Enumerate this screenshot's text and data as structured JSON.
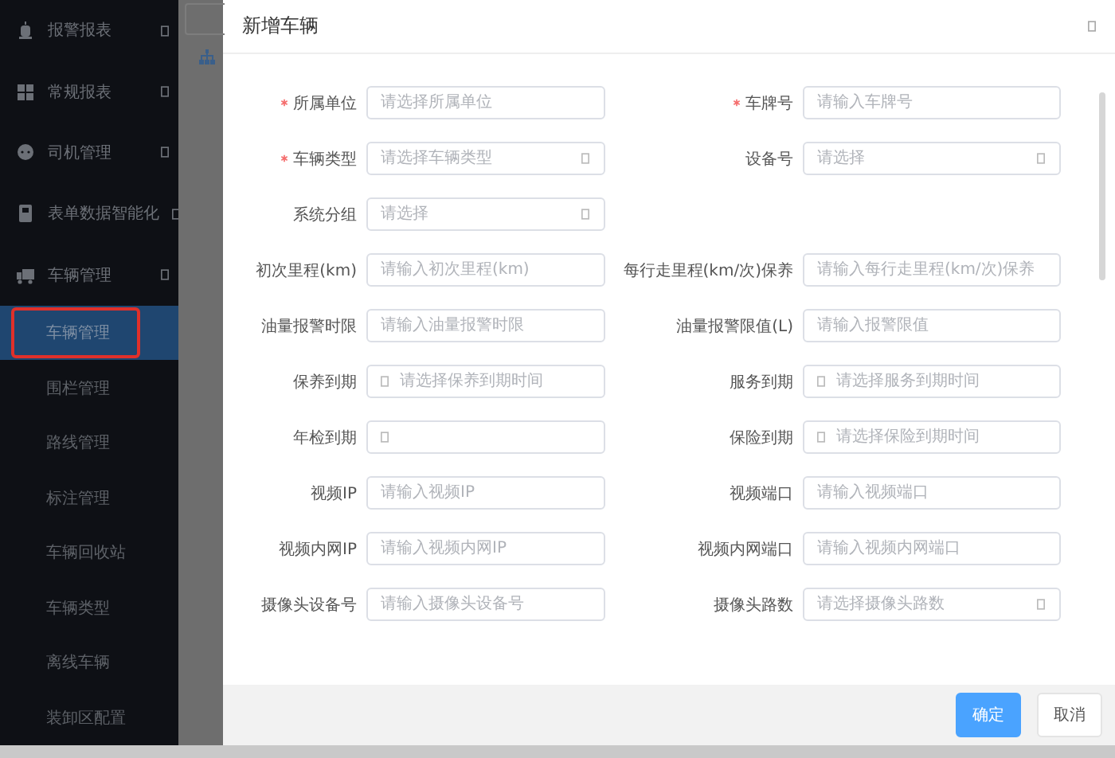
{
  "sidebar": {
    "items": [
      {
        "label": "报警报表",
        "kind": "alarm",
        "expandable": true,
        "selected": false
      },
      {
        "label": "常规报表",
        "kind": "grid",
        "expandable": true,
        "selected": false
      },
      {
        "label": "司机管理",
        "kind": "chat",
        "expandable": true,
        "selected": false
      },
      {
        "label": "表单数据智能化",
        "kind": "doc",
        "expandable": true,
        "selected": false
      },
      {
        "label": "车辆管理",
        "kind": "truck",
        "expandable": true,
        "selected": false,
        "children": [
          {
            "label": "车辆管理",
            "selected": true,
            "highlighted": true
          },
          {
            "label": "围栏管理",
            "selected": false,
            "highlighted": false
          },
          {
            "label": "路线管理",
            "selected": false,
            "highlighted": false
          },
          {
            "label": "标注管理",
            "selected": false,
            "highlighted": false
          },
          {
            "label": "车辆回收站",
            "selected": false,
            "highlighted": false
          },
          {
            "label": "车辆类型",
            "selected": false,
            "highlighted": false
          },
          {
            "label": "离线车辆",
            "selected": false,
            "highlighted": false
          },
          {
            "label": "装卸区配置",
            "selected": false,
            "highlighted": false
          }
        ]
      }
    ]
  },
  "dialog": {
    "title": "新增车辆",
    "rows": [
      [
        {
          "label": "所属单位",
          "required": true,
          "kind": "input",
          "placeholder": "请选择所属单位"
        },
        {
          "label": "车牌号",
          "required": true,
          "kind": "input",
          "placeholder": "请输入车牌号"
        }
      ],
      [
        {
          "label": "车辆类型",
          "required": true,
          "kind": "select",
          "placeholder": "请选择车辆类型"
        },
        {
          "label": "设备号",
          "required": false,
          "kind": "select",
          "placeholder": "请选择"
        }
      ],
      [
        {
          "label": "系统分组",
          "required": false,
          "kind": "select",
          "placeholder": "请选择"
        }
      ],
      [
        {
          "label": "初次里程(km)",
          "required": false,
          "kind": "input",
          "placeholder": "请输入初次里程(km)"
        },
        {
          "label": "每行走里程(km/次)保养",
          "required": false,
          "kind": "input",
          "placeholder": "请输入每行走里程(km/次)保养"
        }
      ],
      [
        {
          "label": "油量报警时限",
          "required": false,
          "kind": "input",
          "placeholder": "请输入油量报警时限"
        },
        {
          "label": "油量报警限值(L)",
          "required": false,
          "kind": "input",
          "placeholder": "请输入报警限值"
        }
      ],
      [
        {
          "label": "保养到期",
          "required": false,
          "kind": "date",
          "placeholder": "请选择保养到期时间"
        },
        {
          "label": "服务到期",
          "required": false,
          "kind": "date",
          "placeholder": "请选择服务到期时间"
        }
      ],
      [
        {
          "label": "年检到期",
          "required": false,
          "kind": "date"
        },
        {
          "label": "保险到期",
          "required": false,
          "kind": "date",
          "placeholder": "请选择保险到期时间"
        }
      ],
      [
        {
          "label": "视频IP",
          "required": false,
          "kind": "input",
          "placeholder": "请输入视频IP"
        },
        {
          "label": "视频端口",
          "required": false,
          "kind": "input",
          "placeholder": "请输入视频端口"
        }
      ],
      [
        {
          "label": "视频内网IP",
          "required": false,
          "kind": "input",
          "placeholder": "请输入视频内网IP"
        },
        {
          "label": "视频内网端口",
          "required": false,
          "kind": "input",
          "placeholder": "请输入视频内网端口"
        }
      ],
      [
        {
          "label": "摄像头设备号",
          "required": false,
          "kind": "input",
          "placeholder": "请输入摄像头设备号"
        },
        {
          "label": "摄像头路数",
          "required": false,
          "kind": "select",
          "placeholder": "请选择摄像头路数"
        }
      ]
    ],
    "buttons": [
      {
        "label": "确定",
        "kind": "primary"
      },
      {
        "label": "取消",
        "kind": "default"
      }
    ]
  }
}
